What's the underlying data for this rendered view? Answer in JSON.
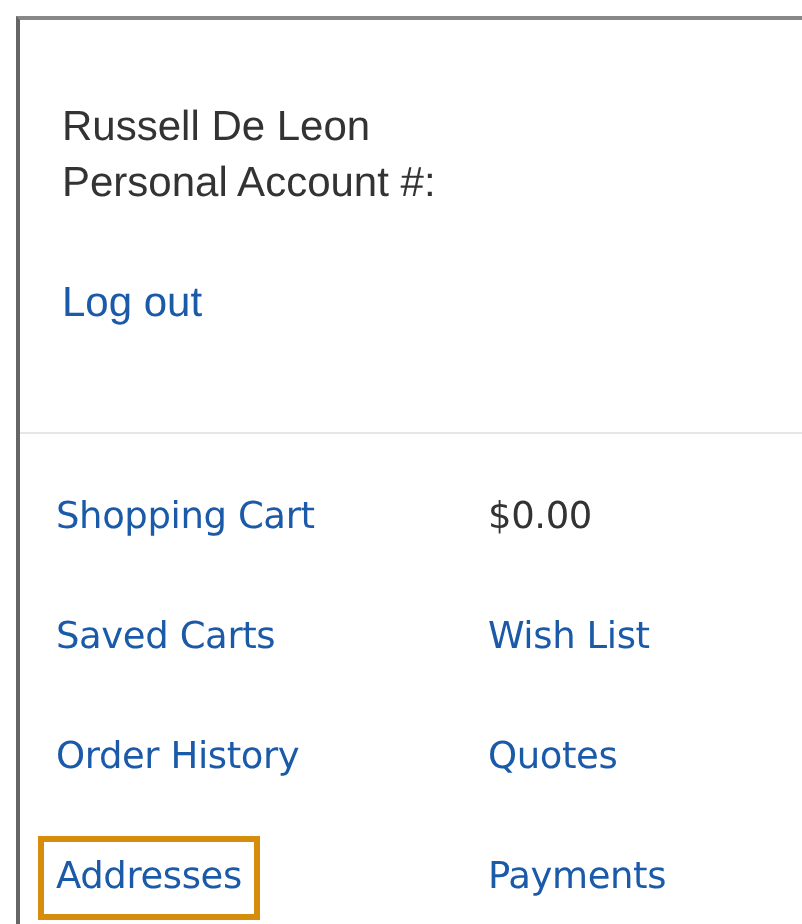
{
  "account": {
    "name": "Russell De Leon",
    "account_label": "Personal Account #:",
    "logout": "Log out"
  },
  "menu": [
    {
      "kind": "link",
      "text": "Shopping Cart",
      "highlighted": false
    },
    {
      "kind": "value",
      "text": "$0.00",
      "highlighted": false
    },
    {
      "kind": "link",
      "text": "Saved Carts",
      "highlighted": false
    },
    {
      "kind": "link",
      "text": "Wish List",
      "highlighted": false
    },
    {
      "kind": "link",
      "text": "Order History",
      "highlighted": false
    },
    {
      "kind": "link",
      "text": "Quotes",
      "highlighted": false
    },
    {
      "kind": "link",
      "text": "Addresses",
      "highlighted": true
    },
    {
      "kind": "link",
      "text": "Payments",
      "highlighted": false
    }
  ]
}
